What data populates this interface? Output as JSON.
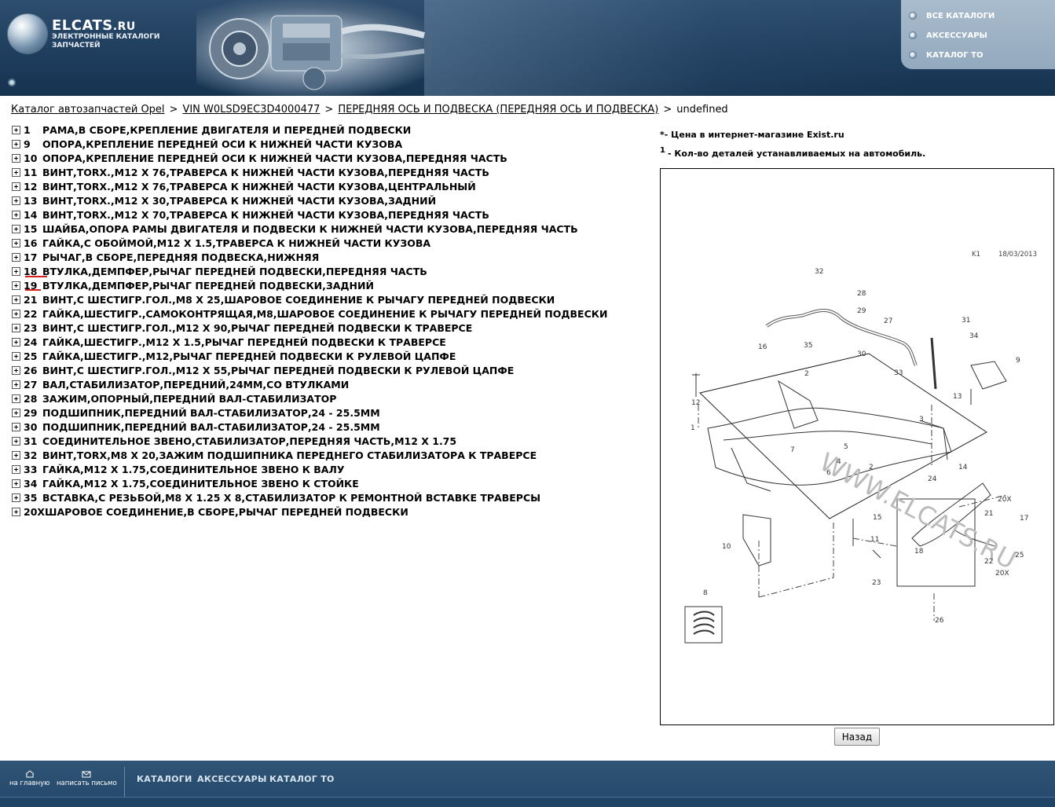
{
  "header": {
    "logo_title": "ELCATS",
    "logo_title_suffix": ".RU",
    "logo_subtitle_1": "ЭЛЕКТРОННЫЕ КАТАЛОГИ",
    "logo_subtitle_2": "ЗАПЧАСТЕЙ",
    "nav": [
      "ВСЕ КАТАЛОГИ",
      "АКСЕССУАРЫ",
      "КАТАЛОГ ТО"
    ]
  },
  "breadcrumb": {
    "items": [
      "Каталог автозапчастей Opel",
      "VIN W0LSD9EC3D4000477",
      "ПЕРЕДНЯЯ ОСЬ И ПОДВЕСКА (ПЕРЕДНЯЯ ОСЬ И ПОДВЕСКА)"
    ],
    "separator": ">",
    "current": "undefined"
  },
  "parts": [
    {
      "num": "1",
      "desc": "РАМА,В СБОРЕ,КРЕПЛЕНИЕ ДВИГАТЕЛЯ И ПЕРЕДНЕЙ ПОДВЕСКИ"
    },
    {
      "num": "9",
      "desc": "ОПОРА,КРЕПЛЕНИЕ ПЕРЕДНЕЙ ОСИ К НИЖНЕЙ ЧАСТИ КУЗОВА"
    },
    {
      "num": "10",
      "desc": "ОПОРА,КРЕПЛЕНИЕ ПЕРЕДНЕЙ ОСИ К НИЖНЕЙ ЧАСТИ КУЗОВА,ПЕРЕДНЯЯ ЧАСТЬ"
    },
    {
      "num": "11",
      "desc": "ВИНТ,TORX.,M12 X 76,ТРАВЕРСА К НИЖНЕЙ ЧАСТИ КУЗОВА,ПЕРЕДНЯЯ ЧАСТЬ"
    },
    {
      "num": "12",
      "desc": "ВИНТ,TORX.,M12 X 76,ТРАВЕРСА К НИЖНЕЙ ЧАСТИ КУЗОВА,ЦЕНТРАЛЬНЫЙ"
    },
    {
      "num": "13",
      "desc": "ВИНТ,TORX.,M12 X 30,ТРАВЕРСА К НИЖНЕЙ ЧАСТИ КУЗОВА,ЗАДНИЙ"
    },
    {
      "num": "14",
      "desc": "ВИНТ,TORX.,M12 X 70,ТРАВЕРСА К НИЖНЕЙ ЧАСТИ КУЗОВА,ПЕРЕДНЯЯ ЧАСТЬ"
    },
    {
      "num": "15",
      "desc": "ШАЙБА,ОПОРА РАМЫ ДВИГАТЕЛЯ И ПОДВЕСКИ К НИЖНЕЙ ЧАСТИ КУЗОВА,ПЕРЕДНЯЯ ЧАСТЬ"
    },
    {
      "num": "16",
      "desc": "ГАЙКА,С ОБОЙМОЙ,M12 X 1.5,ТРАВЕРСА К НИЖНЕЙ ЧАСТИ КУЗОВА"
    },
    {
      "num": "17",
      "desc": "РЫЧАГ,В СБОРЕ,ПЕРЕДНЯЯ ПОДВЕСКА,НИЖНЯЯ"
    },
    {
      "num": "18",
      "desc": "ВТУЛКА,ДЕМПФЕР,РЫЧАГ ПЕРЕДНЕЙ ПОДВЕСКИ,ПЕРЕДНЯЯ ЧАСТЬ"
    },
    {
      "num": "19",
      "desc": "ВТУЛКА,ДЕМПФЕР,РЫЧАГ ПЕРЕДНЕЙ ПОДВЕСКИ,ЗАДНИЙ"
    },
    {
      "num": "21",
      "desc": "ВИНТ,С ШЕСТИГР.ГОЛ.,M8 X 25,ШАРОВОЕ СОЕДИНЕНИЕ К РЫЧАГУ ПЕРЕДНЕЙ ПОДВЕСКИ"
    },
    {
      "num": "22",
      "desc": "ГАЙКА,ШЕСТИГР.,САМОКОНТРЯЩАЯ,M8,ШАРОВОЕ СОЕДИНЕНИЕ К РЫЧАГУ ПЕРЕДНЕЙ ПОДВЕСКИ"
    },
    {
      "num": "23",
      "desc": "ВИНТ,С ШЕСТИГР.ГОЛ.,M12 X 90,РЫЧАГ ПЕРЕДНЕЙ ПОДВЕСКИ К ТРАВЕРСЕ"
    },
    {
      "num": "24",
      "desc": "ГАЙКА,ШЕСТИГР.,M12 X 1.5,РЫЧАГ ПЕРЕДНЕЙ ПОДВЕСКИ К ТРАВЕРСЕ"
    },
    {
      "num": "25",
      "desc": "ГАЙКА,ШЕСТИГР.,M12,РЫЧАГ ПЕРЕДНЕЙ ПОДВЕСКИ К РУЛЕВОЙ ЦАПФЕ"
    },
    {
      "num": "26",
      "desc": "ВИНТ,С ШЕСТИГР.ГОЛ.,M12 X 55,РЫЧАГ ПЕРЕДНЕЙ ПОДВЕСКИ К РУЛЕВОЙ ЦАПФЕ"
    },
    {
      "num": "27",
      "desc": "ВАЛ,СТАБИЛИЗАТОР,ПЕРЕДНИЙ,24ММ,СО ВТУЛКАМИ"
    },
    {
      "num": "28",
      "desc": "ЗАЖИМ,ОПОРНЫЙ,ПЕРЕДНИЙ ВАЛ-СТАБИЛИЗАТОР"
    },
    {
      "num": "29",
      "desc": "ПОДШИПНИК,ПЕРЕДНИЙ ВАЛ-СТАБИЛИЗАТОР,24 - 25.5ММ"
    },
    {
      "num": "30",
      "desc": "ПОДШИПНИК,ПЕРЕДНИЙ ВАЛ-СТАБИЛИЗАТОР,24 - 25.5ММ"
    },
    {
      "num": "31",
      "desc": "СОЕДИНИТЕЛЬНОЕ ЗВЕНО,СТАБИЛИЗАТОР,ПЕРЕДНЯЯ ЧАСТЬ,M12 X 1.75"
    },
    {
      "num": "32",
      "desc": "ВИНТ,TORX,M8 X 20,ЗАЖИМ ПОДШИПНИКА ПЕРЕДНЕГО СТАБИЛИЗАТОРА К ТРАВЕРСЕ"
    },
    {
      "num": "33",
      "desc": "ГАЙКА,M12 X 1.75,СОЕДИНИТЕЛЬНОЕ ЗВЕНО К ВАЛУ"
    },
    {
      "num": "34",
      "desc": "ГАЙКА,M12 X 1.75,СОЕДИНИТЕЛЬНОЕ ЗВЕНО К СТОЙКЕ"
    },
    {
      "num": "35",
      "desc": "ВСТАВКА,С РЕЗЬБОЙ,M8 X 1.25 X 8,СТАБИЛИЗАТОР К РЕМОНТНОЙ ВСТАВКЕ ТРАВЕРСЫ"
    },
    {
      "num": "20X",
      "desc": "ШАРОВОЕ СОЕДИНЕНИЕ,В СБОРЕ,РЫЧАГ ПЕРЕДНЕЙ ПОДВЕСКИ"
    }
  ],
  "notes": {
    "price_marker": "*",
    "price_text": " - Цена в интернет-магазине Exist.ru",
    "qty_marker": "1",
    "qty_text": " - Кол-во деталей устанавливаемых на автомобиль."
  },
  "diagram": {
    "code": "K1",
    "date": "18/03/2013",
    "watermark": "WWW.ELCATS.RU",
    "callouts": [
      "1",
      "2",
      "2",
      "3",
      "4",
      "5",
      "6",
      "7",
      "8",
      "9",
      "10",
      "11",
      "12",
      "13",
      "14",
      "15",
      "16",
      "17",
      "18",
      "20X",
      "20X",
      "21",
      "22",
      "23",
      "24",
      "25",
      "26",
      "27",
      "28",
      "29",
      "30",
      "31",
      "32",
      "33",
      "34",
      "35"
    ]
  },
  "back_button": "Назад",
  "footer": {
    "home_label": "на главную",
    "mail_label": "написать письмо",
    "nav": [
      "КАТАЛОГИ",
      "АКСЕССУАРЫ",
      "КАТАЛОГ ТО"
    ]
  }
}
